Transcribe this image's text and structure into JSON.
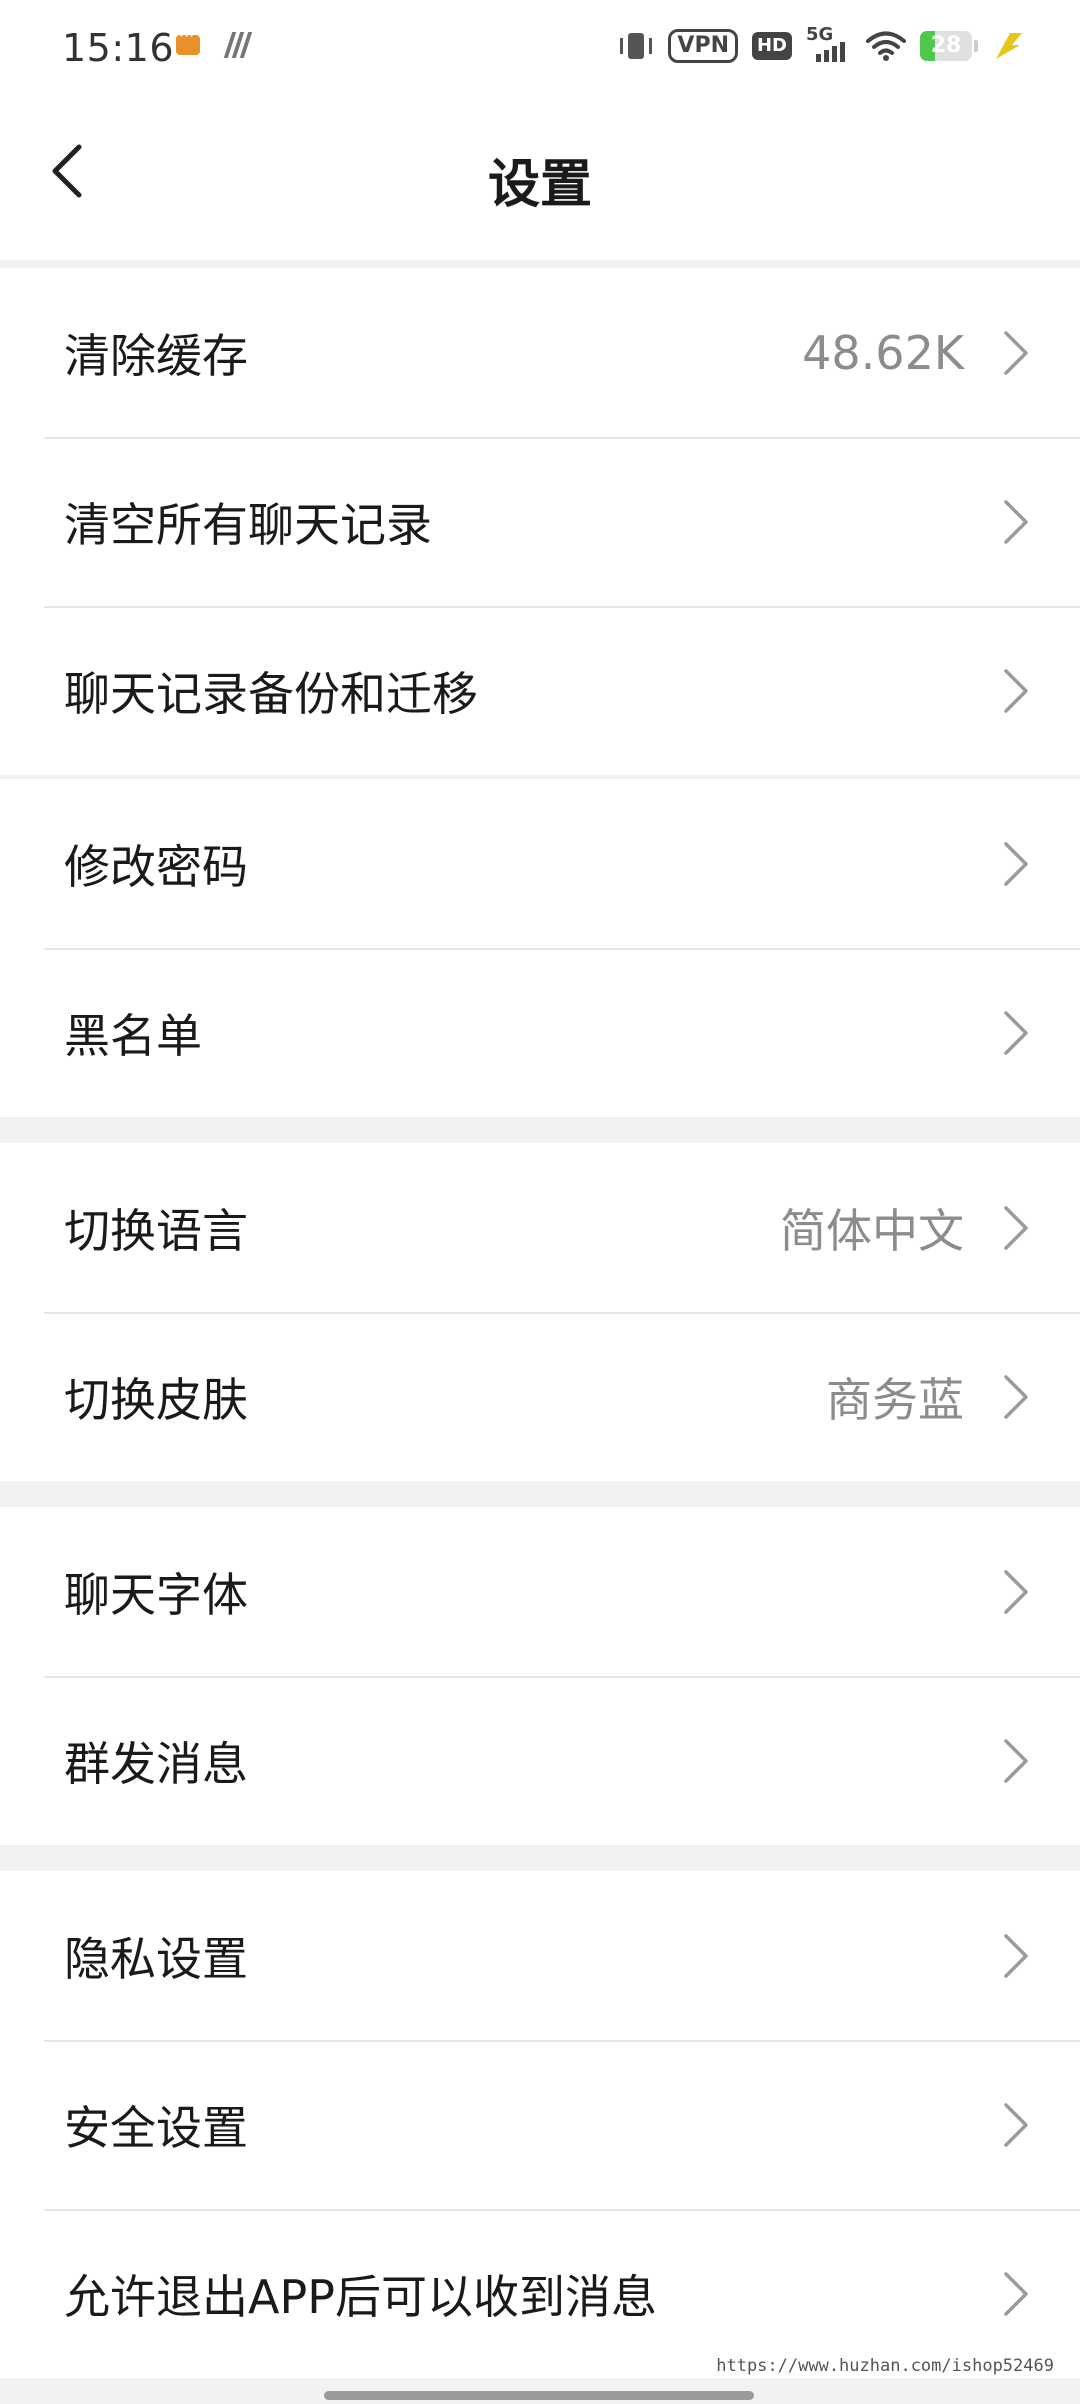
{
  "status_bar": {
    "time": "15:16",
    "icons": [
      "message-notification-icon",
      "stripes-app-icon",
      "vibrate-icon",
      "vpn-icon",
      "hd-icon",
      "signal-5g-icon",
      "wifi-icon",
      "battery-icon",
      "charging-bolt-icon"
    ],
    "vpn_label": "VPN",
    "hd_label": "HD",
    "network_label": "5G",
    "battery_level": "28",
    "battery_fraction": 0.28,
    "accent_green": "#4cc94c",
    "bolt_color": "#e6c619"
  },
  "header": {
    "back_icon": "chevron-left-icon",
    "title": "设置"
  },
  "groups": [
    {
      "rows": [
        {
          "label": "清除缓存",
          "value": "48.62K"
        },
        {
          "label": "清空所有聊天记录",
          "value": ""
        },
        {
          "label": "聊天记录备份和迁移",
          "value": ""
        }
      ]
    },
    {
      "rows": [
        {
          "label": "修改密码",
          "value": ""
        },
        {
          "label": "黑名单",
          "value": ""
        }
      ]
    },
    {
      "rows": [
        {
          "label": "切换语言",
          "value": "简体中文"
        },
        {
          "label": "切换皮肤",
          "value": "商务蓝"
        }
      ]
    },
    {
      "rows": [
        {
          "label": "聊天字体",
          "value": ""
        },
        {
          "label": "群发消息",
          "value": ""
        }
      ]
    },
    {
      "rows": [
        {
          "label": "隐私设置",
          "value": ""
        },
        {
          "label": "安全设置",
          "value": ""
        },
        {
          "label": "允许退出APP后可以收到消息",
          "value": ""
        }
      ]
    }
  ],
  "watermark": "https://www.huzhan.com/ishop52469",
  "colors": {
    "background": "#f2f2f2",
    "row_background": "#ffffff",
    "label_text": "#1a1a1a",
    "value_text": "#8c8c8c",
    "chevron": "#9a9a9a"
  }
}
